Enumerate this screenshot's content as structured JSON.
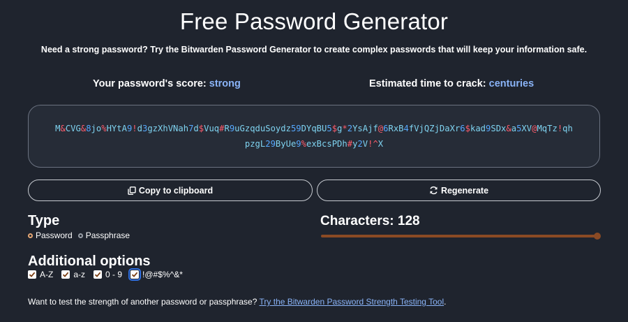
{
  "page": {
    "title": "Free Password Generator",
    "subtitle": "Need a strong password? Try the Bitwarden Password Generator to create complex passwords that will keep your information safe."
  },
  "score": {
    "label": "Your password's score:",
    "value": "strong"
  },
  "crack": {
    "label": "Estimated time to crack:",
    "value": "centuries"
  },
  "password": {
    "line1": "M&CVG&8jo%HYtA9!d3gzXhVNah7d$Vuq#R9uGzqduSoydz59DYqBU5$g*2YsAjf@6RxB4fVjQZjDaXr6$kad9SDx&a5XV@MqTz!qh",
    "line2": "pzgL29ByUe9%exBcsPDh#y2V!^X"
  },
  "buttons": {
    "copy": "Copy to clipboard",
    "regenerate": "Regenerate"
  },
  "type": {
    "title": "Type",
    "options": [
      "Password",
      "Passphrase"
    ],
    "selected": "Password"
  },
  "characters": {
    "label": "Characters: 128",
    "value": 128
  },
  "options": {
    "title": "Additional options",
    "items": [
      {
        "label": "A-Z",
        "checked": true
      },
      {
        "label": "a-z",
        "checked": true
      },
      {
        "label": "0 - 9",
        "checked": true
      },
      {
        "label": "!@#$%^&*",
        "checked": true
      }
    ]
  },
  "footer": {
    "text": "Want to test the strength of another password or passphrase? ",
    "link": "Try the Bitwarden Password Strength Testing Tool",
    "suffix": "."
  },
  "colors": {
    "background": "#1f242e",
    "accent": "#8ab4f8",
    "password_letters": "#7fd3f0",
    "password_digits": "#55a8ff",
    "password_symbols": "#ff5c6c",
    "slider": "#8a4a24",
    "radio_selected": "#e6a774"
  }
}
